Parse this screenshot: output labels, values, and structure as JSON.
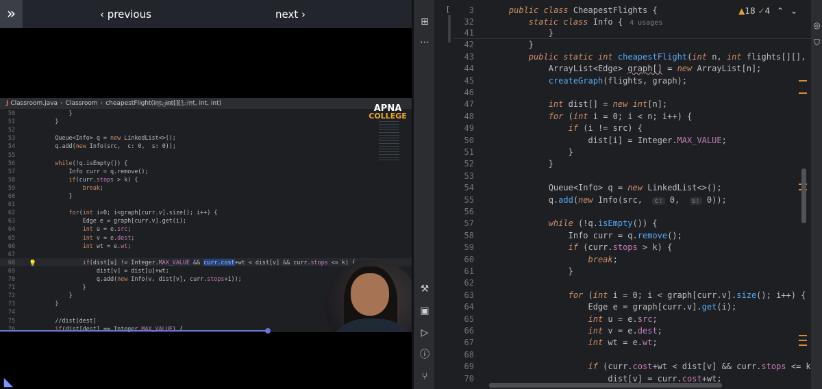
{
  "player": {
    "toggle_icon": "»",
    "prev_label": "‹ previous",
    "next_label": "next ›",
    "progress_fraction": 0.65
  },
  "video": {
    "breadcrumb": [
      "Classroom.java",
      "Classroom",
      "cheapestFlight(int, int[][], int, int, int)"
    ],
    "watermark": "@gmail.com",
    "logo_line1": "APNA",
    "logo_line2": "COLLEGE",
    "lines": [
      {
        "n": "50",
        "t": "            }"
      },
      {
        "n": "51",
        "t": "        }"
      },
      {
        "n": "52",
        "t": ""
      },
      {
        "n": "53",
        "t": "        Queue<Info> q = new LinkedList<>();"
      },
      {
        "n": "54",
        "t": "        q.add(new Info(src,  c: 0,  s: 0));"
      },
      {
        "n": "55",
        "t": ""
      },
      {
        "n": "56",
        "t": "        while(!q.isEmpty()) {"
      },
      {
        "n": "57",
        "t": "            Info curr = q.remove();"
      },
      {
        "n": "58",
        "t": "            if(curr.stops > k) {"
      },
      {
        "n": "59",
        "t": "                break;"
      },
      {
        "n": "60",
        "t": "            }"
      },
      {
        "n": "61",
        "t": ""
      },
      {
        "n": "62",
        "t": "            for(int i=0; i<graph[curr.v].size(); i++) {"
      },
      {
        "n": "63",
        "t": "                Edge e = graph[curr.v].get(i);"
      },
      {
        "n": "64",
        "t": "                int u = e.src;"
      },
      {
        "n": "65",
        "t": "                int v = e.dest;"
      },
      {
        "n": "66",
        "t": "                int wt = e.wt;"
      },
      {
        "n": "67",
        "t": ""
      },
      {
        "n": "68",
        "t": "                if(dist[u] != Integer.MAX_VALUE && curr.cost+wt < dist[v] && curr.stops <= k) {"
      },
      {
        "n": "69",
        "t": "                    dist[v] = dist[u]+wt;"
      },
      {
        "n": "70",
        "t": "                    q.add(new Info(v, dist[v], curr.stops+1));"
      },
      {
        "n": "71",
        "t": "                }"
      },
      {
        "n": "72",
        "t": "            }"
      },
      {
        "n": "73",
        "t": "        }"
      },
      {
        "n": "74",
        "t": ""
      },
      {
        "n": "75",
        "t": "        //dist[dest]"
      },
      {
        "n": "76",
        "t": "        if(dist[dest] == Integer.MAX_VALUE) {"
      }
    ]
  },
  "ide": {
    "tab_fragment": "[",
    "inspections": {
      "warnings": "18",
      "ok": "4"
    },
    "sticky": [
      {
        "n": "3",
        "t": "    public class CheapestFlights {"
      },
      {
        "n": "32",
        "t": "        static class Info {",
        "usage": "4 usages"
      }
    ],
    "lines": [
      {
        "n": "41",
        "t": "            }"
      },
      {
        "n": "42",
        "t": "        }"
      },
      {
        "n": "43",
        "t": "        public static int cheapestFlight(int n, int flights[][], int src, int"
      },
      {
        "n": "44",
        "t": "            ArrayList<Edge> graph[] = new ArrayList[n];"
      },
      {
        "n": "45",
        "t": "            createGraph(flights, graph);"
      },
      {
        "n": "46",
        "t": ""
      },
      {
        "n": "47",
        "t": "            int dist[] = new int[n];"
      },
      {
        "n": "48",
        "t": "            for (int i = 0; i < n; i++) {"
      },
      {
        "n": "49",
        "t": "                if (i != src) {"
      },
      {
        "n": "50",
        "t": "                    dist[i] = Integer.MAX_VALUE;"
      },
      {
        "n": "51",
        "t": "                }"
      },
      {
        "n": "52",
        "t": "            }"
      },
      {
        "n": "53",
        "t": ""
      },
      {
        "n": "54",
        "t": "            Queue<Info> q = new LinkedList<>();"
      },
      {
        "n": "55",
        "t": "            q.add(new Info(src,  c: 0,  s: 0));"
      },
      {
        "n": "56",
        "t": ""
      },
      {
        "n": "57",
        "t": "            while (!q.isEmpty()) {"
      },
      {
        "n": "58",
        "t": "                Info curr = q.remove();"
      },
      {
        "n": "59",
        "t": "                if (curr.stops > k) {"
      },
      {
        "n": "60",
        "t": "                    break;"
      },
      {
        "n": "61",
        "t": "                }"
      },
      {
        "n": "62",
        "t": ""
      },
      {
        "n": "63",
        "t": "                for (int i = 0; i < graph[curr.v].size(); i++) {"
      },
      {
        "n": "64",
        "t": "                    Edge e = graph[curr.v].get(i);"
      },
      {
        "n": "65",
        "t": "                    int u = e.src;"
      },
      {
        "n": "66",
        "t": "                    int v = e.dest;"
      },
      {
        "n": "67",
        "t": "                    int wt = e.wt;"
      },
      {
        "n": "68",
        "t": ""
      },
      {
        "n": "69",
        "t": "                    if (curr.cost+wt < dist[v] && curr.stops <= k) {"
      },
      {
        "n": "70",
        "t": "                        dist[v] = curr.cost+wt;"
      }
    ],
    "keywords": [
      "public",
      "static",
      "class",
      "int",
      "new",
      "for",
      "if",
      "while",
      "break"
    ],
    "fields": [
      "MAX_VALUE",
      "src",
      "dest",
      "wt",
      "stops",
      "cost",
      "v"
    ],
    "functions": [
      "cheapestFlight",
      "createGraph",
      "isEmpty",
      "remove",
      "add",
      "size",
      "get"
    ],
    "colors": {
      "keyword": "#cf8e6d",
      "function": "#56a8f5",
      "field": "#c77dbb",
      "text": "#bcbec4",
      "lineno": "#6f737a",
      "warning": "#e2a33b",
      "ok": "#5fb865"
    },
    "toolstrip_icons": [
      "project-structure-icon",
      "more-icon",
      "hammer-icon",
      "terminal-icon",
      "run-icon",
      "problems-icon",
      "git-icon"
    ],
    "rightstrip_icons": [
      "ai-assistant-icon",
      "shield-icon"
    ]
  }
}
